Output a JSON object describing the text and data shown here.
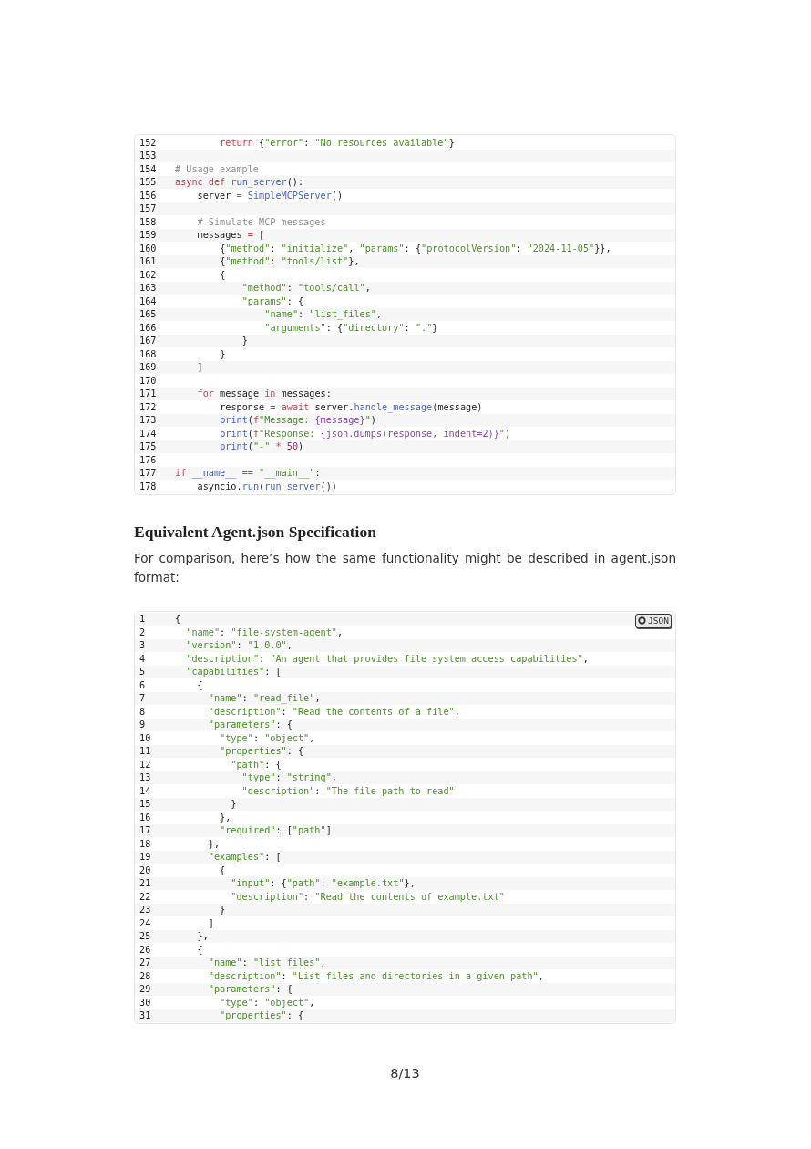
{
  "python_listing": {
    "kind": "python",
    "lines": [
      {
        "number": "152",
        "code": "        return {\"error\": \"No resources available\"}"
      },
      {
        "number": "153"
      },
      {
        "number": "154",
        "code": "# Usage example"
      },
      {
        "number": "155",
        "code": "async def run_server():"
      },
      {
        "number": "156",
        "code": "    server = SimpleMCPServer()"
      },
      {
        "number": "157"
      },
      {
        "number": "158",
        "code": "    # Simulate MCP messages"
      },
      {
        "number": "159",
        "code": "    messages = ["
      },
      {
        "number": "160",
        "code": "        {\"method\": \"initialize\", \"params\": {\"protocolVersion\": \"2024-11-05\"}},"
      },
      {
        "number": "161",
        "code": "        {\"method\": \"tools/list\"},"
      },
      {
        "number": "162",
        "code": "        {"
      },
      {
        "number": "163",
        "code": "            \"method\": \"tools/call\","
      },
      {
        "number": "164",
        "code": "            \"params\": {"
      },
      {
        "number": "165",
        "code": "                \"name\": \"list_files\","
      },
      {
        "number": "166",
        "code": "                \"arguments\": {\"directory\": \".\"}"
      },
      {
        "number": "167",
        "code": "            }"
      },
      {
        "number": "168",
        "code": "        }"
      },
      {
        "number": "169",
        "code": "    ]"
      },
      {
        "number": "170"
      },
      {
        "number": "171",
        "code": "    for message in messages:"
      },
      {
        "number": "172",
        "code": "        response = await server.handle_message(message)"
      },
      {
        "number": "173",
        "code": "        print(f\"Message: {message}\")"
      },
      {
        "number": "174",
        "code": "        print(f\"Response: {json.dumps(response, indent=2)}\")"
      },
      {
        "number": "175",
        "code": "        print(\"-\" * 50)"
      },
      {
        "number": "176"
      },
      {
        "number": "177",
        "code": "if __name__ == \"__main__\":"
      },
      {
        "number": "178",
        "code": "    asyncio.run(run_server())"
      }
    ]
  },
  "section": {
    "heading": "Equivalent Agent.json Specification",
    "paragraph": "For comparison, here’s how the same functionality might be described in agent.json format:"
  },
  "json_listing": {
    "kind": "json",
    "badge": "JSON",
    "lines": [
      {
        "number": "1",
        "code": "{"
      },
      {
        "number": "2",
        "code": "  \"name\": \"file-system-agent\","
      },
      {
        "number": "3",
        "code": "  \"version\": \"1.0.0\","
      },
      {
        "number": "4",
        "code": "  \"description\": \"An agent that provides file system access capabilities\","
      },
      {
        "number": "5",
        "code": "  \"capabilities\": ["
      },
      {
        "number": "6",
        "code": "    {"
      },
      {
        "number": "7",
        "code": "      \"name\": \"read_file\","
      },
      {
        "number": "8",
        "code": "      \"description\": \"Read the contents of a file\","
      },
      {
        "number": "9",
        "code": "      \"parameters\": {"
      },
      {
        "number": "10",
        "code": "        \"type\": \"object\","
      },
      {
        "number": "11",
        "code": "        \"properties\": {"
      },
      {
        "number": "12",
        "code": "          \"path\": {"
      },
      {
        "number": "13",
        "code": "            \"type\": \"string\","
      },
      {
        "number": "14",
        "code": "            \"description\": \"The file path to read\""
      },
      {
        "number": "15",
        "code": "          }"
      },
      {
        "number": "16",
        "code": "        },"
      },
      {
        "number": "17",
        "code": "        \"required\": [\"path\"]"
      },
      {
        "number": "18",
        "code": "      },"
      },
      {
        "number": "19",
        "code": "      \"examples\": ["
      },
      {
        "number": "20",
        "code": "        {"
      },
      {
        "number": "21",
        "code": "          \"input\": {\"path\": \"example.txt\"},"
      },
      {
        "number": "22",
        "code": "          \"description\": \"Read the contents of example.txt\""
      },
      {
        "number": "23",
        "code": "        }"
      },
      {
        "number": "24",
        "code": "      ]"
      },
      {
        "number": "25",
        "code": "    },"
      },
      {
        "number": "26",
        "code": "    {"
      },
      {
        "number": "27",
        "code": "      \"name\": \"list_files\","
      },
      {
        "number": "28",
        "code": "      \"description\": \"List files and directories in a given path\","
      },
      {
        "number": "29",
        "code": "      \"parameters\": {"
      },
      {
        "number": "30",
        "code": "        \"type\": \"object\","
      },
      {
        "number": "31",
        "code": "        \"properties\": {"
      }
    ]
  },
  "page_number": "8/13"
}
